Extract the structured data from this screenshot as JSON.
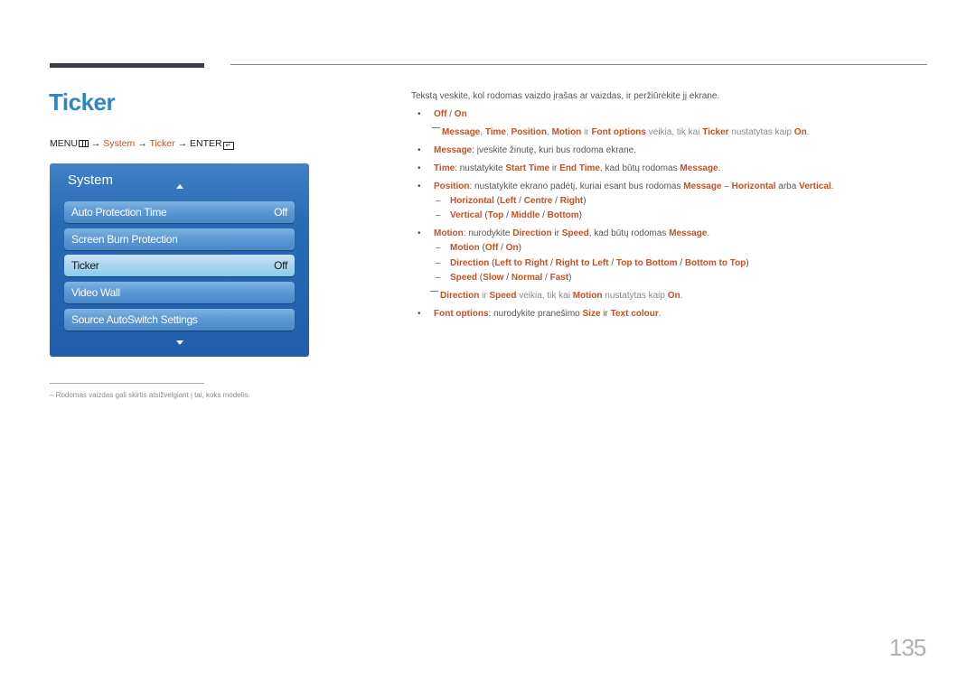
{
  "title": "Ticker",
  "menu_path": {
    "menu": "MENU",
    "menu_icon": "menu-grid-icon",
    "arrow": "→",
    "system": "System",
    "ticker": "Ticker",
    "enter": "ENTER",
    "enter_icon": "enter-icon"
  },
  "osd": {
    "title": "System",
    "up_icon": "triangle-up-icon",
    "down_icon": "triangle-down-icon",
    "items": [
      {
        "label": "Auto Protection Time",
        "value": "Off"
      },
      {
        "label": "Screen Burn Protection",
        "value": ""
      },
      {
        "label": "Ticker",
        "value": "Off",
        "selected": true
      },
      {
        "label": "Video Wall",
        "value": ""
      },
      {
        "label": "Source AutoSwitch Settings",
        "value": ""
      }
    ]
  },
  "footnote": "Rodomas vaizdas gali skirtis atsižvelgiant į tai, koks modelis.",
  "content": {
    "intro": "Tekstą veskite, kol rodomas vaizdo įrašas ar vaizdas, ir peržiūrėkite jį ekrane.",
    "off_on": {
      "off": "Off",
      "sep": " / ",
      "on": "On"
    },
    "note1": {
      "message": "Message",
      "c1": ", ",
      "time": "Time",
      "c2": ", ",
      "position": "Position",
      "c3": ", ",
      "motion": "Motion",
      "ir": " ir ",
      "font_options": "Font options",
      "text": " veikia, tik kai ",
      "ticker": "Ticker",
      "text2": " nustatytas kaip ",
      "on": "On",
      "end": "."
    },
    "message_line": {
      "key": "Message",
      "text": ": įveskite žinutę, kuri bus rodoma ekrane."
    },
    "time_line": {
      "key": "Time",
      "t1": ": nustatykite ",
      "start": "Start Time",
      "ir": " ir ",
      "end_time": "End Time",
      "t2": ", kad būtų rodomas ",
      "message": "Message",
      "end": "."
    },
    "position_line": {
      "key": "Position",
      "t1": ": nustatykite ekrano padėtį, kuriai esant bus rodomas ",
      "message": "Message",
      "dash": " – ",
      "horizontal": "Horizontal",
      "arba": " arba ",
      "vertical": "Vertical",
      "end": "."
    },
    "horizontal_sub": {
      "key": "Horizontal",
      "open": " (",
      "a": "Left",
      "b": "Centre",
      "c": "Right",
      "close": ")",
      "sep": " / "
    },
    "vertical_sub": {
      "key": "Vertical",
      "open": " (",
      "a": "Top",
      "b": "Middle",
      "c": "Bottom",
      "close": ")",
      "sep": " / "
    },
    "motion_line": {
      "key": "Motion",
      "t1": ": nurodykite ",
      "direction": "Direction",
      "ir": " ir ",
      "speed": "Speed",
      "t2": ", kad būtų rodomas ",
      "message": "Message",
      "end": "."
    },
    "motion_sub": {
      "key": "Motion",
      "open": " (",
      "a": "Off",
      "b": "On",
      "close": ")",
      "sep": " / "
    },
    "direction_sub": {
      "key": "Direction",
      "open": " (",
      "a": "Left to Right",
      "b": "Right to Left",
      "c": "Top to Bottom",
      "d": "Bottom to Top",
      "close": ")",
      "sep": " / "
    },
    "speed_sub": {
      "key": "Speed",
      "open": " (",
      "a": "Slow",
      "b": "Normal",
      "c": "Fast",
      "close": ")",
      "sep": " / "
    },
    "note2": {
      "direction": "Direction",
      "ir": " ir ",
      "speed": "Speed",
      "text": " veikia, tik kai ",
      "motion": "Motion",
      "text2": " nustatytas kaip ",
      "on": "On",
      "end": "."
    },
    "font_line": {
      "key": "Font options",
      "t1": ": nurodykite pranešimo ",
      "size": "Size",
      "ir": " ir ",
      "colour": "Text colour",
      "end": "."
    }
  },
  "page_number": "135",
  "colors": {
    "title": "#2f86c5",
    "highlight": "#c8501f",
    "osd_bg": "#1f5eab"
  }
}
